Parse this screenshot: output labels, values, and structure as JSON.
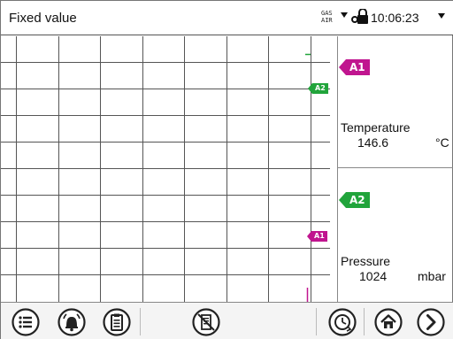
{
  "header": {
    "title": "Fixed value",
    "gas_air": [
      "GAS",
      "AIR"
    ],
    "time": "10:06:23"
  },
  "chart": {
    "marker_a2": "A2",
    "marker_a1": "A1"
  },
  "channels": [
    {
      "tag": "A1",
      "color": "#c0158f",
      "name": "Temperature",
      "value": "146.6",
      "unit": "°C"
    },
    {
      "tag": "A2",
      "color": "#21a43b",
      "name": "Pressure",
      "value": "1024",
      "unit": "mbar"
    }
  ],
  "toolbar": {
    "icons": [
      "list-icon",
      "alarm-bell-icon",
      "clipboard-icon",
      "no-document-icon",
      "clock-refresh-icon",
      "home-icon",
      "next-arrow-icon"
    ]
  }
}
